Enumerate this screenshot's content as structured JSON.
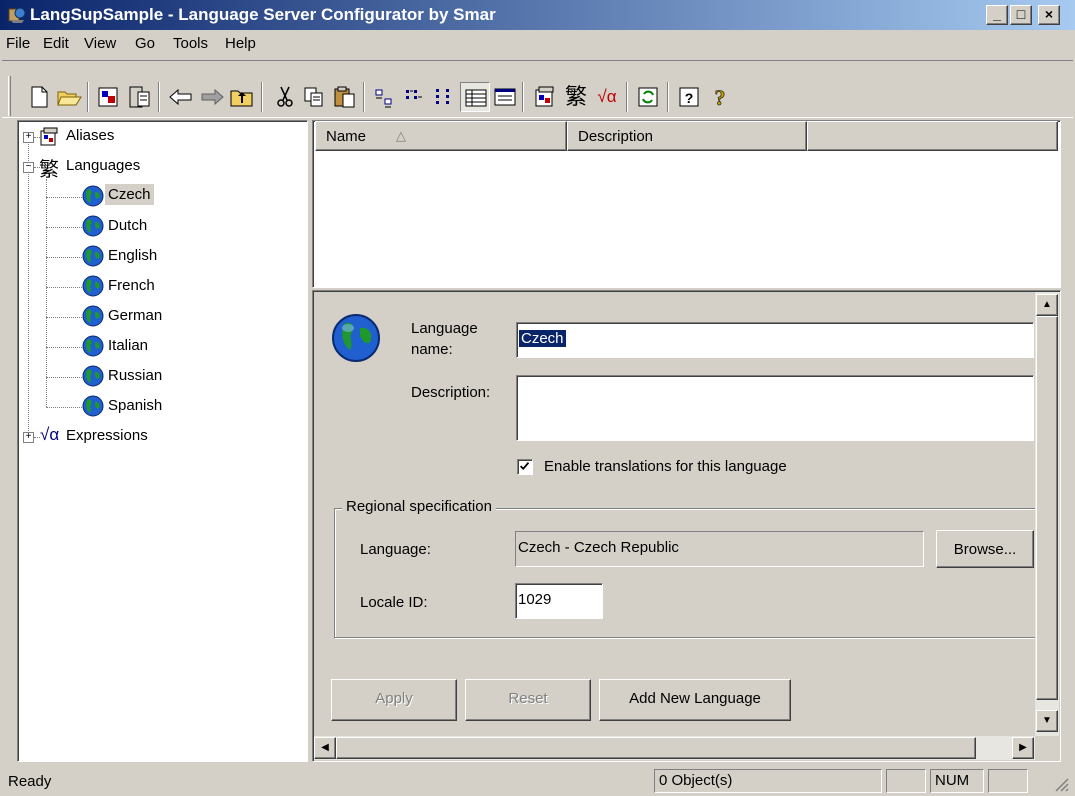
{
  "window": {
    "title": "LangSupSample - Language Server Configurator by Smar",
    "minimize": "_",
    "maximize": "□",
    "close": "×"
  },
  "menu": [
    "File",
    "Edit",
    "View",
    "Go",
    "Tools",
    "Help"
  ],
  "toolbar": {
    "buttons": [
      "new-icon",
      "open-icon",
      "properties-icon",
      "server-icon",
      "back-arrow-icon",
      "forward-arrow-icon",
      "up-folder-icon",
      "cut-icon",
      "copy-icon",
      "paste-icon",
      "large-icons-icon",
      "small-icons-icon",
      "list-icon",
      "details-icon",
      "report-icon",
      "alias-icon",
      "languages-icon",
      "expressions-icon",
      "refresh-icon",
      "help-icon",
      "whats-this-icon"
    ]
  },
  "tree": {
    "aliases": "Aliases",
    "languages": "Languages",
    "children": [
      "Czech",
      "Dutch",
      "English",
      "French",
      "German",
      "Italian",
      "Russian",
      "Spanish"
    ],
    "selected": "Czech",
    "expressions": "Expressions",
    "alias_glyph": "📄",
    "languages_glyph": "繁",
    "expressions_glyph": "√α"
  },
  "list": {
    "columns": [
      "Name",
      "Description"
    ],
    "sort_arrow": "△"
  },
  "detail": {
    "language_name_label_1": "Language",
    "language_name_label_2": "name:",
    "language_name_value": "Czech",
    "description_label": "Description:",
    "description_value": "",
    "enable_checkbox_label": "Enable translations for this language",
    "enable_checked": true,
    "group_title": "Regional specification",
    "language_label": "Language:",
    "language_value": "Czech - Czech Republic",
    "browse_button": "Browse...",
    "locale_label": "Locale ID:",
    "locale_value": "1029",
    "apply_button": "Apply",
    "reset_button": "Reset",
    "add_button": "Add New Language"
  },
  "status": {
    "ready": "Ready",
    "objects": "0 Object(s)",
    "num": "NUM"
  },
  "colors": {
    "title_active_start": "#0a246a",
    "title_active_end": "#a6caf0",
    "selection": "#0a246a",
    "face": "#d4d0c8"
  }
}
